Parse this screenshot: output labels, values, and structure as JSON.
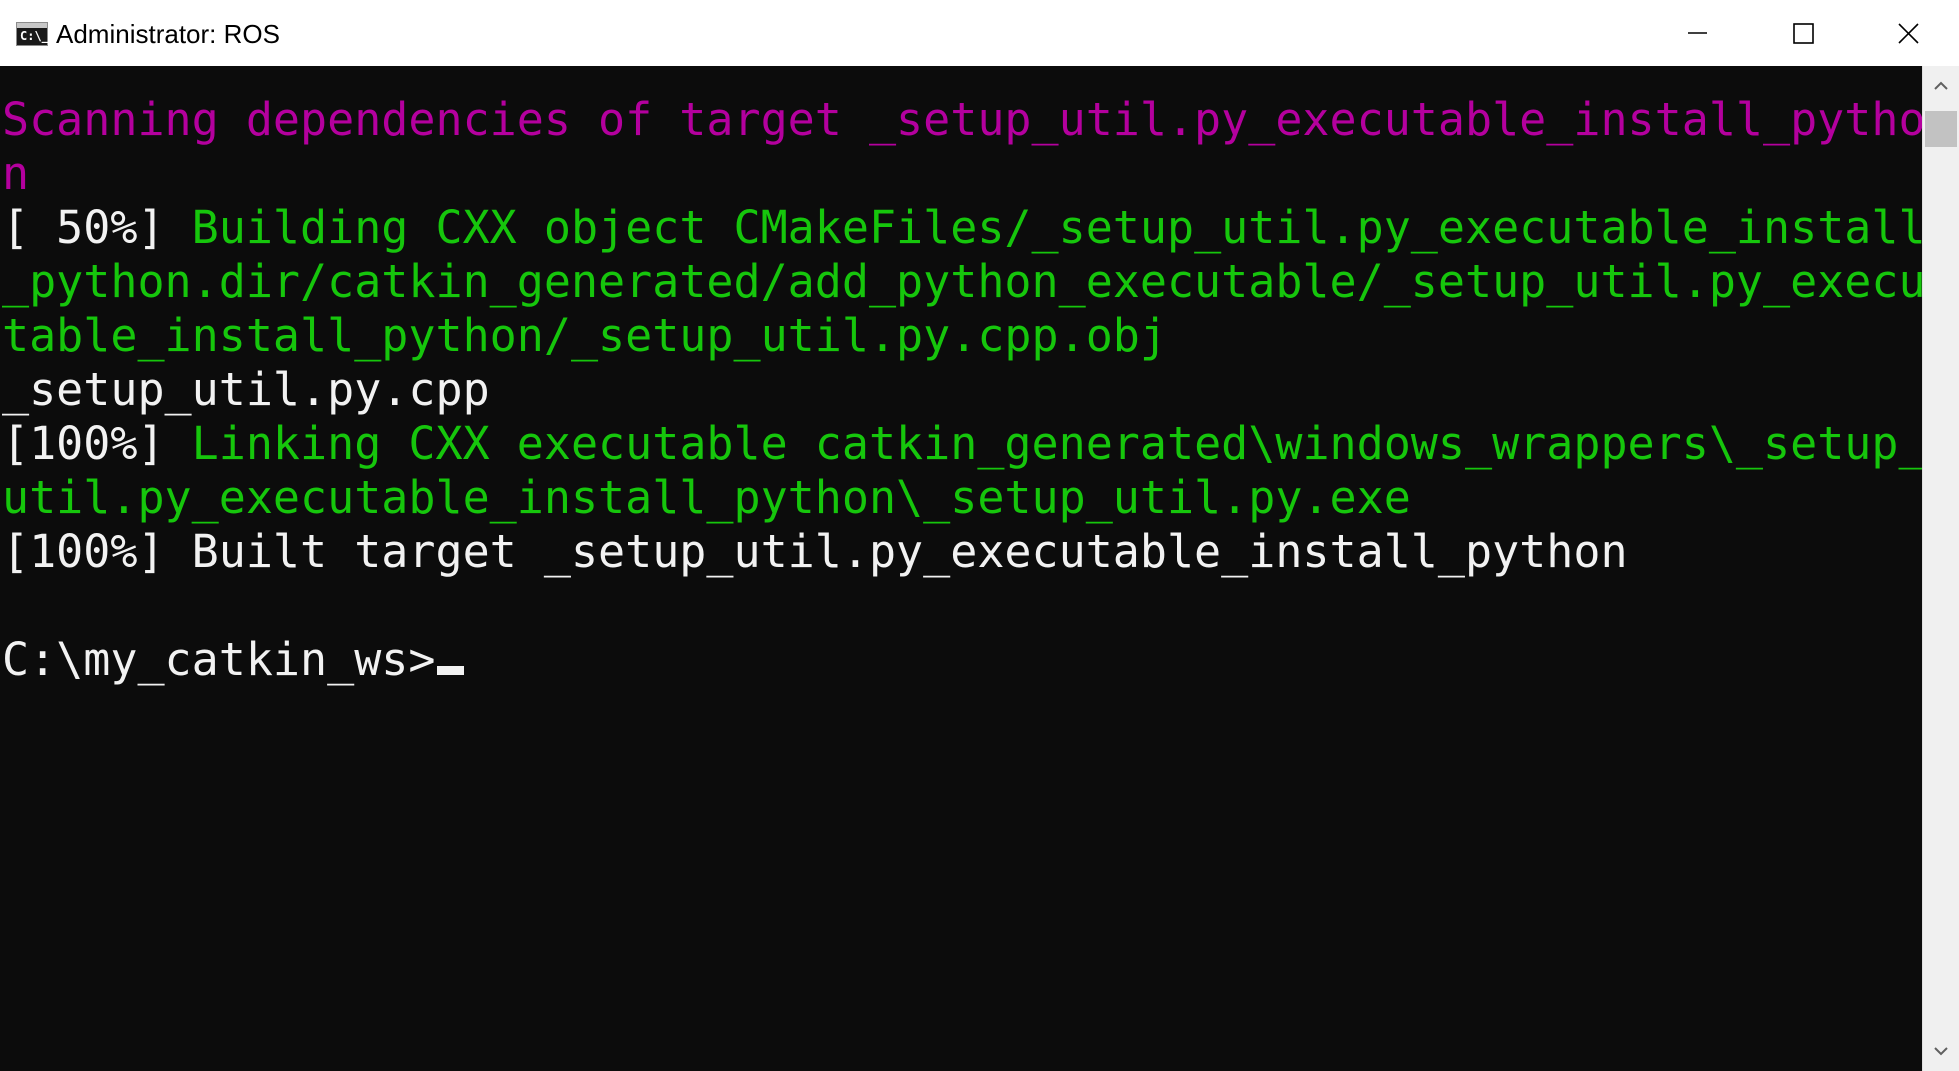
{
  "window": {
    "title": "Administrator: ROS",
    "icon": "cmd-icon",
    "icon_text": "C:\\_"
  },
  "controls": {
    "minimize": "minimize-icon",
    "maximize": "maximize-icon",
    "close": "close-icon"
  },
  "console": {
    "lines": [
      {
        "segments": [
          {
            "text": "Scanning dependencies of target _setup_util.py_executable_install_pytho",
            "color": "#b4009e"
          }
        ]
      },
      {
        "segments": [
          {
            "text": "n",
            "color": "#b4009e"
          }
        ]
      },
      {
        "segments": [
          {
            "text": "[ 50%] ",
            "color": "#f2f2f2"
          },
          {
            "text": "Building CXX object CMakeFiles/_setup_util.py_executable_install",
            "color": "#16c60c"
          }
        ]
      },
      {
        "segments": [
          {
            "text": "_python.dir/catkin_generated/add_python_executable/_setup_util.py_execu",
            "color": "#16c60c"
          }
        ]
      },
      {
        "segments": [
          {
            "text": "table_install_python/_setup_util.py.cpp.obj",
            "color": "#16c60c"
          }
        ]
      },
      {
        "segments": [
          {
            "text": "_setup_util.py.cpp",
            "color": "#f2f2f2"
          }
        ]
      },
      {
        "segments": [
          {
            "text": "[100%] ",
            "color": "#f2f2f2"
          },
          {
            "text": "Linking CXX executable catkin_generated\\windows_wrappers\\_setup_",
            "color": "#16c60c"
          }
        ]
      },
      {
        "segments": [
          {
            "text": "util.py_executable_install_python\\_setup_util.py.exe",
            "color": "#16c60c"
          }
        ]
      },
      {
        "segments": [
          {
            "text": "[100%] Built target _setup_util.py_executable_install_python",
            "color": "#f2f2f2"
          }
        ]
      },
      {
        "segments": [
          {
            "text": "",
            "color": "#f2f2f2"
          }
        ]
      },
      {
        "segments": [
          {
            "text": "C:\\my_catkin_ws>",
            "color": "#f2f2f2"
          }
        ],
        "cursor": true
      }
    ]
  },
  "scrollbar": {
    "up": "chevron-up-icon",
    "down": "chevron-down-icon"
  }
}
